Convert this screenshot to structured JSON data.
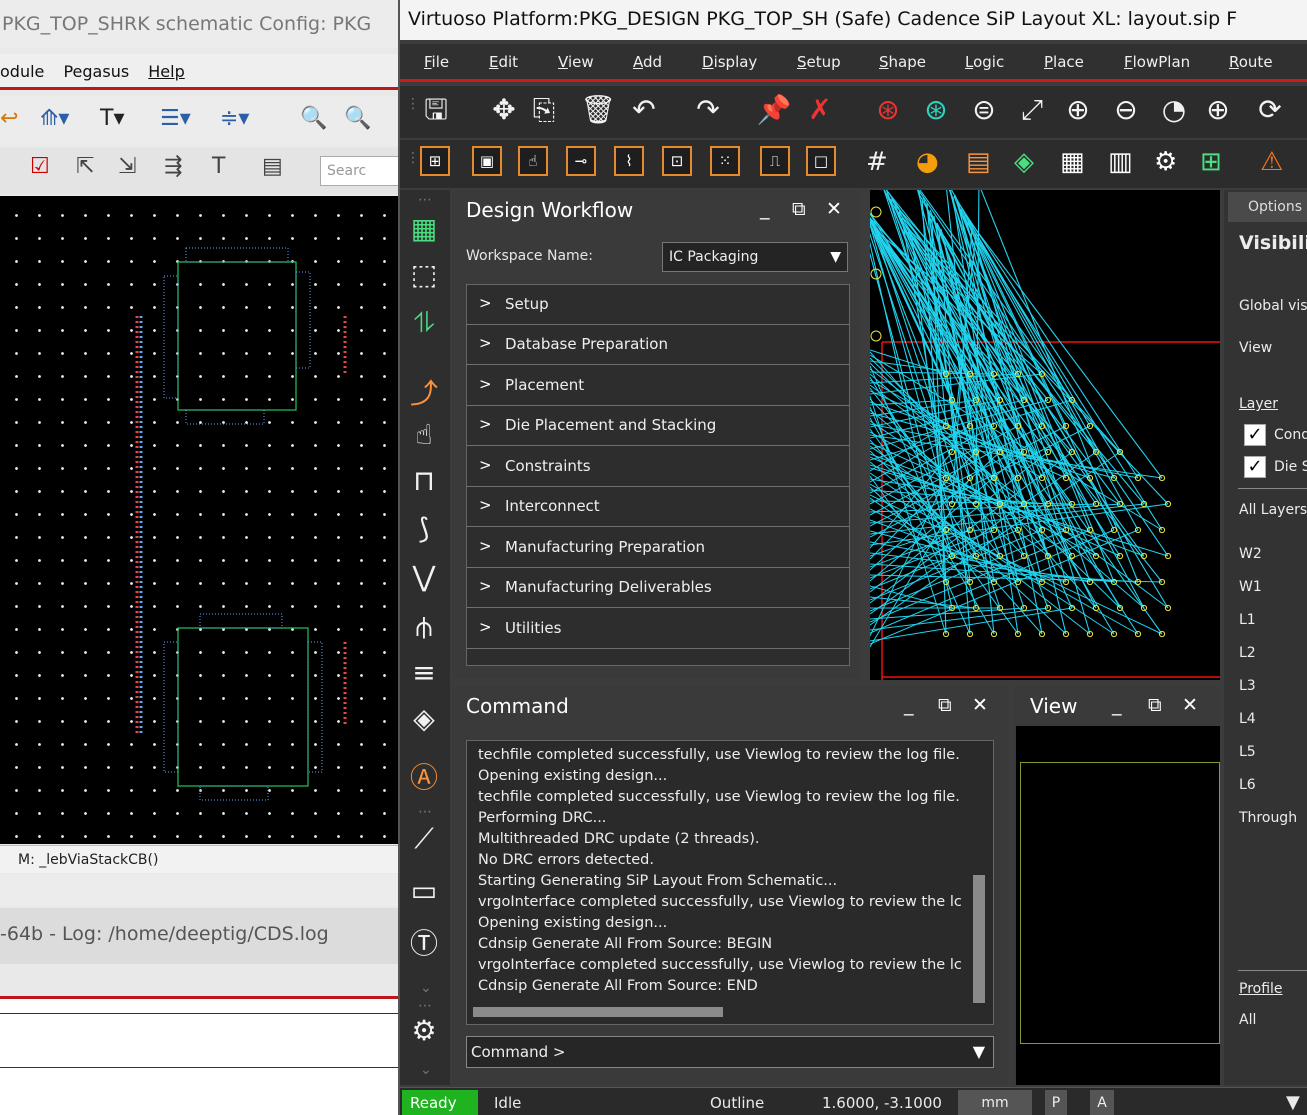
{
  "left_window": {
    "title": "PKG_TOP_SHRK schematic  Config: PKG",
    "menu": [
      "odule",
      "Pegasus",
      "Help"
    ],
    "search_placeholder": "Searc",
    "status_message": "M: _lebViaStackCB()",
    "log_text": "-64b - Log: /home/deeptig/CDS.log"
  },
  "main_window": {
    "title": "Virtuoso Platform:PKG_DESIGN PKG_TOP_SH (Safe) Cadence SiP Layout XL: layout.sip  F",
    "menu": [
      "File",
      "Edit",
      "View",
      "Add",
      "Display",
      "Setup",
      "Shape",
      "Logic",
      "Place",
      "FlowPlan",
      "Route"
    ]
  },
  "design_workflow": {
    "title": "Design Workflow",
    "workspace_label": "Workspace Name:",
    "workspace_value": "IC Packaging",
    "items": [
      "Setup",
      "Database Preparation",
      "Placement",
      "Die Placement and Stacking",
      "Constraints",
      "Interconnect",
      "Manufacturing Preparation",
      "Manufacturing Deliverables",
      "Utilities"
    ]
  },
  "options_panel": {
    "tab": "Options",
    "heading": "Visibilit",
    "global_label": "Global vis",
    "view_label": "View",
    "layer_label": "Layer",
    "checks": [
      "Cond",
      "Die S"
    ],
    "all_layers": "All Layers",
    "layers": [
      "W2",
      "W1",
      "L1",
      "L2",
      "L3",
      "L4",
      "L5",
      "L6",
      "Through"
    ],
    "profile_label": "Profile",
    "profile_value": "All"
  },
  "command": {
    "title": "Command",
    "log": [
      "techfile completed successfully, use Viewlog to review the log file.",
      "Opening existing design...",
      "techfile completed successfully, use Viewlog to review the log file.",
      "Performing DRC...",
      "Multithreaded DRC update (2 threads).",
      "No DRC errors detected.",
      "Starting Generating SiP Layout From Schematic...",
      "vrgoInterface completed successfully, use Viewlog to review the lc",
      "Opening existing design...",
      "Cdnsip Generate All From Source: BEGIN",
      "vrgoInterface completed successfully, use Viewlog to review the lc",
      "Cdnsip Generate All From Source: END"
    ],
    "prompt": "Command >"
  },
  "view_panel": {
    "title": "View"
  },
  "status_bar": {
    "ready": "Ready",
    "state": "Idle",
    "mode": "Outline",
    "coords": "1.6000, -3.1000",
    "units": "mm",
    "btn_p": "P",
    "btn_a": "A"
  },
  "colors": {
    "accent_red": "#d01a1a",
    "ready_green": "#1fb31f",
    "ratsnest_cyan": "#22d3ee",
    "pin_yellow": "#e8e83a",
    "die_outline_green": "#22c55e"
  }
}
